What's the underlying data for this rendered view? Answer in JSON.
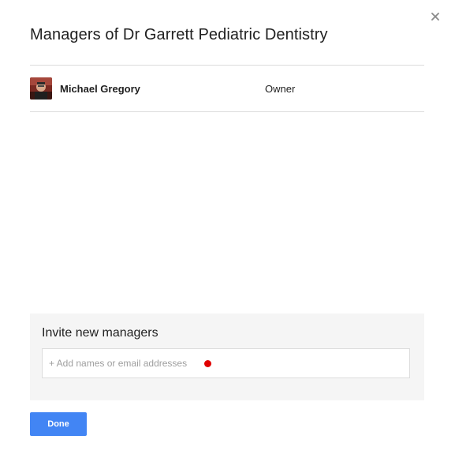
{
  "dialog": {
    "title": "Managers of Dr Garrett Pediatric Dentistry",
    "close_icon": "close-icon"
  },
  "managers": [
    {
      "name": "Michael Gregory",
      "role": "Owner",
      "avatar_icon": "avatar"
    }
  ],
  "invite": {
    "title": "Invite new managers",
    "placeholder": "+ Add names or email addresses"
  },
  "footer": {
    "done_label": "Done"
  },
  "colors": {
    "accent": "#4285f4",
    "panel_bg": "#f5f5f5",
    "divider": "#dcdcdc",
    "cursor_marker": "#e00000"
  }
}
